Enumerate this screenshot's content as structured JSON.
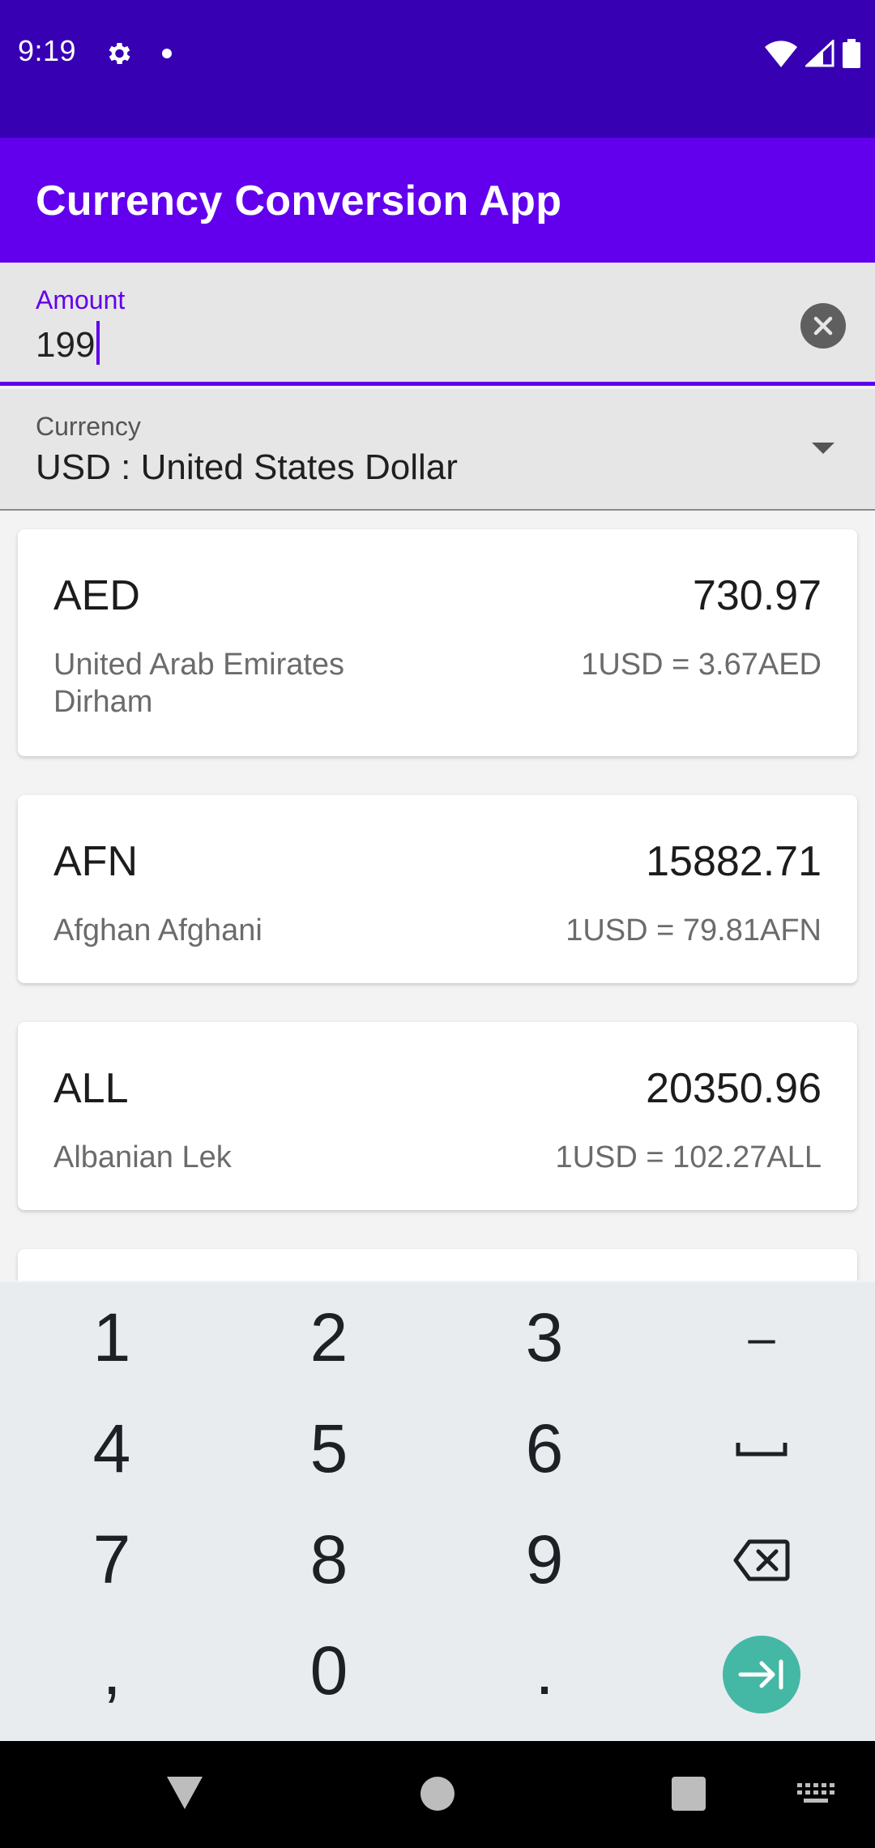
{
  "status_bar": {
    "time": "9:19",
    "icons": [
      "settings-icon",
      "notification-dot",
      "wifi-icon",
      "signal-icon",
      "battery-icon"
    ]
  },
  "app_bar": {
    "title": "Currency Conversion App"
  },
  "amount_field": {
    "label": "Amount",
    "value": "199"
  },
  "currency_field": {
    "label": "Currency",
    "value": "USD : United States Dollar"
  },
  "conversions": [
    {
      "code": "AED",
      "amount": "730.97",
      "name": "United Arab Emirates Dirham",
      "rate": "1USD = 3.67AED"
    },
    {
      "code": "AFN",
      "amount": "15882.71",
      "name": "Afghan Afghani",
      "rate": "1USD = 79.81AFN"
    },
    {
      "code": "ALL",
      "amount": "20350.96",
      "name": "Albanian Lek",
      "rate": "1USD = 102.27ALL"
    }
  ],
  "keyboard": {
    "rows": [
      [
        "1",
        "2",
        "3",
        "–"
      ],
      [
        "4",
        "5",
        "6",
        "space"
      ],
      [
        "7",
        "8",
        "9",
        "backspace"
      ],
      [
        ",",
        "0",
        ".",
        "go"
      ]
    ]
  },
  "colors": {
    "status_bar": "#3700b3",
    "primary": "#6200ee",
    "go_key": "#44b8a5"
  }
}
